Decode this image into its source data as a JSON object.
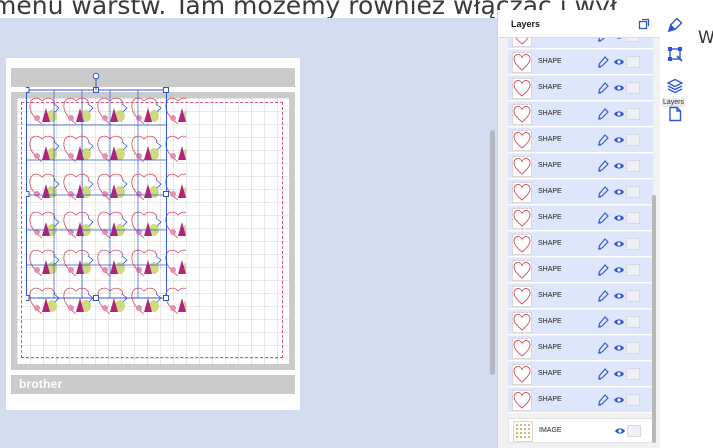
{
  "caption": {
    "segment_1": "menu warstw. Tam możemy również włączać i wył",
    "right_letter": "W"
  },
  "mat": {
    "brand": "brother"
  },
  "layers_panel": {
    "title": "Layers",
    "items": [
      {
        "name": "SHAPE",
        "type": "shape"
      },
      {
        "name": "SHAPE",
        "type": "shape"
      },
      {
        "name": "SHAPE",
        "type": "shape"
      },
      {
        "name": "SHAPE",
        "type": "shape"
      },
      {
        "name": "SHAPE",
        "type": "shape"
      },
      {
        "name": "SHAPE",
        "type": "shape"
      },
      {
        "name": "SHAPE",
        "type": "shape"
      },
      {
        "name": "SHAPE",
        "type": "shape"
      },
      {
        "name": "SHAPE",
        "type": "shape"
      },
      {
        "name": "SHAPE",
        "type": "shape"
      },
      {
        "name": "SHAPE",
        "type": "shape"
      },
      {
        "name": "SHAPE",
        "type": "shape"
      },
      {
        "name": "SHAPE",
        "type": "shape"
      },
      {
        "name": "SHAPE",
        "type": "shape"
      },
      {
        "name": "SHAPE",
        "type": "shape"
      },
      {
        "name": "IMAGE",
        "type": "image"
      }
    ]
  },
  "toolbar": {
    "tools": [
      {
        "icon": "brush-icon"
      },
      {
        "icon": "transform-icon"
      },
      {
        "icon": "layers-icon",
        "label": "Layers",
        "active": true
      },
      {
        "icon": "page-icon"
      }
    ]
  },
  "colors": {
    "canvas_bg": "#d3dcef",
    "selected_row": "#dde6fa",
    "accent_blue": "#2f55d4",
    "cut_line": "#e05070"
  }
}
